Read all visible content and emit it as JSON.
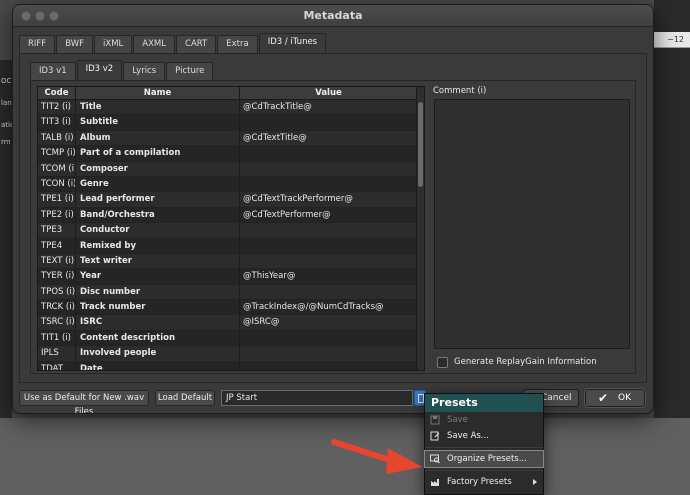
{
  "background": {
    "ruler_value": "−12",
    "left_fragments": [
      "OCE",
      "lan",
      "atio",
      "rm"
    ]
  },
  "dialog": {
    "title": "Metadata",
    "tabs": [
      "RIFF",
      "BWF",
      "iXML",
      "AXML",
      "CART",
      "Extra",
      "ID3 / iTunes"
    ],
    "active_tab": "ID3 / iTunes",
    "subtabs": [
      "ID3 v1",
      "ID3 v2",
      "Lyrics",
      "Picture"
    ],
    "active_subtab": "ID3 v2",
    "table": {
      "headers": [
        "Code",
        "Name",
        "Value"
      ],
      "rows": [
        {
          "code": "TIT2 (i)",
          "name": "Title",
          "value": "@CdTrackTitle@"
        },
        {
          "code": "TIT3 (i)",
          "name": "Subtitle",
          "value": ""
        },
        {
          "code": "TALB (i)",
          "name": "Album",
          "value": "@CdTextTitle@"
        },
        {
          "code": "TCMP (i)",
          "name": "Part of a compilation",
          "value": ""
        },
        {
          "code": "TCOM (i)",
          "name": "Composer",
          "value": ""
        },
        {
          "code": "TCON (i)",
          "name": "Genre",
          "value": ""
        },
        {
          "code": "TPE1 (i)",
          "name": "Lead performer",
          "value": "@CdTextTrackPerformer@"
        },
        {
          "code": "TPE2 (i)",
          "name": "Band/Orchestra",
          "value": "@CdTextPerformer@"
        },
        {
          "code": "TPE3",
          "name": "Conductor",
          "value": ""
        },
        {
          "code": "TPE4",
          "name": "Remixed by",
          "value": ""
        },
        {
          "code": "TEXT (i)",
          "name": "Text writer",
          "value": ""
        },
        {
          "code": "TYER (i)",
          "name": "Year",
          "value": "@ThisYear@"
        },
        {
          "code": "TPOS (i)",
          "name": "Disc number",
          "value": ""
        },
        {
          "code": "TRCK (i)",
          "name": "Track number",
          "value": "@TrackIndex@/@NumCdTracks@"
        },
        {
          "code": "TSRC (i)",
          "name": "ISRC",
          "value": "@ISRC@"
        },
        {
          "code": "TIT1 (i)",
          "name": "Content description",
          "value": ""
        },
        {
          "code": "IPLS",
          "name": "Involved people",
          "value": ""
        },
        {
          "code": "TDAT",
          "name": "Date",
          "value": ""
        }
      ]
    },
    "comment_label": "Comment (i)",
    "replaygain_label": "Generate ReplayGain Information",
    "use_default_label": "Use as Default for New .wav Files",
    "load_default_label": "Load Default",
    "preset_value": "JP Start",
    "cancel_label": "Cancel",
    "ok_label": "OK"
  },
  "presets_menu": {
    "title": "Presets",
    "items": [
      {
        "label": "Save",
        "icon": "save-icon",
        "enabled": false
      },
      {
        "label": "Save As...",
        "icon": "save-as-icon",
        "enabled": true
      },
      {
        "label": "Organize Presets...",
        "icon": "organize-icon",
        "enabled": true,
        "highlighted": true
      },
      {
        "label": "Factory Presets",
        "icon": "factory-presets-icon",
        "enabled": true,
        "submenu": true
      }
    ]
  },
  "colors": {
    "menu_header": "#205050",
    "annotation_arrow": "#e8452f",
    "preset_button": "#3a78c8"
  }
}
